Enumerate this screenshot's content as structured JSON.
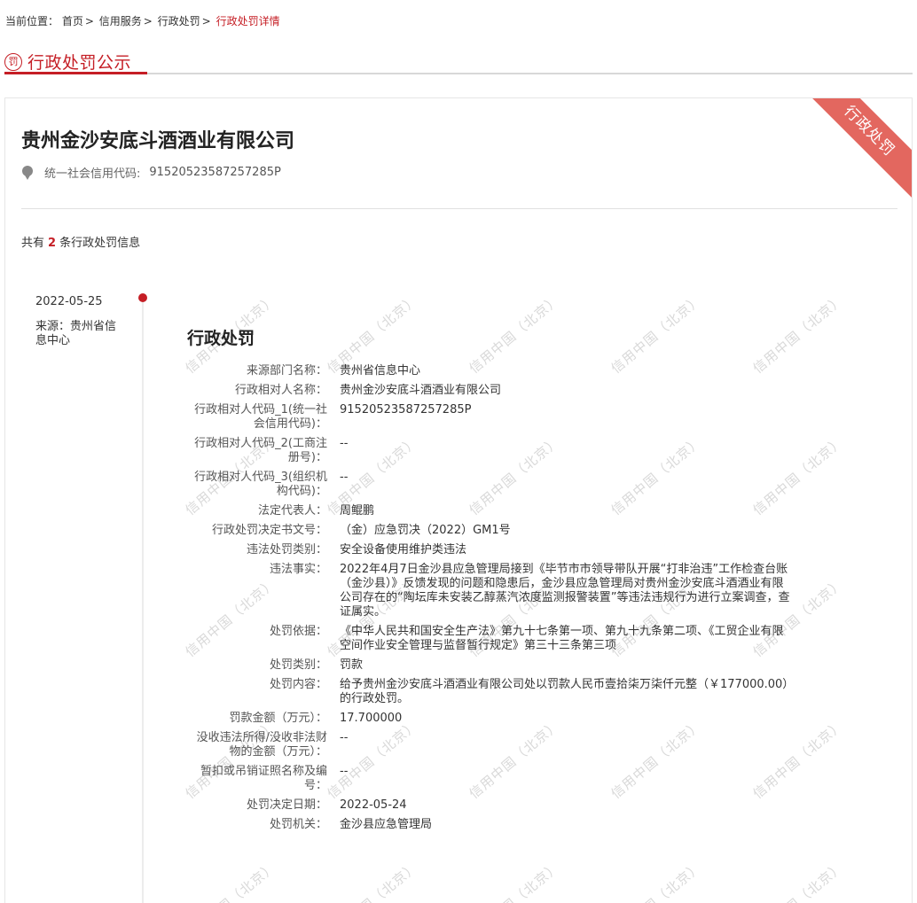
{
  "breadcrumb": {
    "label": "当前位置：",
    "items": [
      "首页",
      "信用服务",
      "行政处罚"
    ],
    "separator": ">",
    "current": "行政处罚详情"
  },
  "section": {
    "icon": "罚",
    "title": "行政处罚公示"
  },
  "card": {
    "ribbon": "行政处罚",
    "company": "贵州金沙安底斗酒酒业有限公司",
    "credit_label": "统一社会信用代码:",
    "credit_code": "91520523587257285P",
    "count_prefix": "共有",
    "count_value": "2",
    "count_suffix": "条行政处罚信息"
  },
  "record": {
    "date": "2022-05-25",
    "source": "来源：贵州省信息中心",
    "title": "行政处罚",
    "fields": [
      {
        "k": "来源部门名称：",
        "v": "贵州省信息中心"
      },
      {
        "k": "行政相对人名称：",
        "v": "贵州金沙安底斗酒酒业有限公司"
      },
      {
        "k": "行政相对人代码_1(统一社会信用代码)：",
        "v": "91520523587257285P"
      },
      {
        "k": "行政相对人代码_2(工商注册号)：",
        "v": "--"
      },
      {
        "k": "行政相对人代码_3(组织机构代码)：",
        "v": "--"
      },
      {
        "k": "法定代表人：",
        "v": "周鲲鹏"
      },
      {
        "k": "行政处罚决定书文号：",
        "v": "（金）应急罚决（2022）GM1号"
      },
      {
        "k": "违法处罚类别：",
        "v": "安全设备使用维护类违法"
      },
      {
        "k": "违法事实：",
        "v": "2022年4月7日金沙县应急管理局接到《毕节市市领导带队开展“打非治违”工作检查台账（金沙县）》反馈发现的问题和隐患后，金沙县应急管理局对贵州金沙安底斗酒酒业有限公司存在的“陶坛库未安装乙醇蒸汽浓度监测报警装置”等违法违规行为进行立案调查，查证属实。"
      },
      {
        "k": "处罚依据：",
        "v": "《中华人民共和国安全生产法》第九十七条第一项、第九十九条第二项、《工贸企业有限空间作业安全管理与监督暂行规定》第三十三条第三项"
      },
      {
        "k": "处罚类别：",
        "v": "罚款"
      },
      {
        "k": "处罚内容：",
        "v": "给予贵州金沙安底斗酒酒业有限公司处以罚款人民币壹拾柒万柒仟元整（￥177000.00）的行政处罚。"
      },
      {
        "k": "罚款金额（万元）：",
        "v": "17.700000"
      },
      {
        "k": "没收违法所得/没收非法财物的金额（万元）：",
        "v": "--"
      },
      {
        "k": "暂扣或吊销证照名称及编号：",
        "v": "--"
      },
      {
        "k": "处罚决定日期：",
        "v": "2022-05-24"
      },
      {
        "k": "处罚机关：",
        "v": "金沙县应急管理局"
      }
    ]
  },
  "watermark_text": "信用中国（北京）",
  "colors": {
    "accent": "#c51e25",
    "ribbon": "#e3675f"
  }
}
